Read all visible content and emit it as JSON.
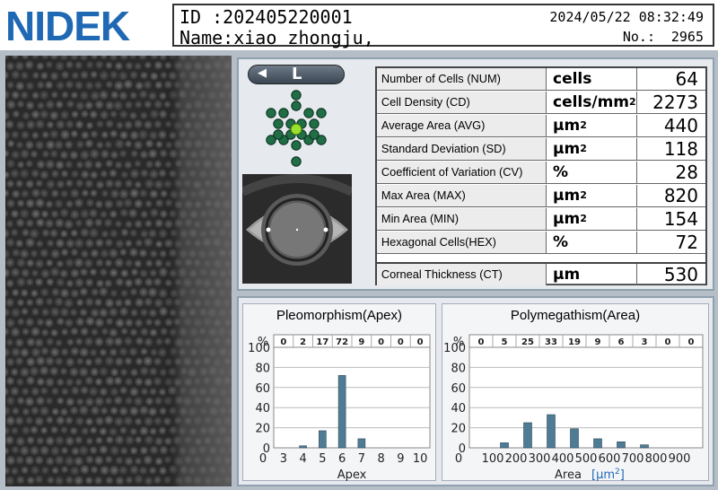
{
  "header": {
    "brand": "NIDEK",
    "id_line": "ID  :202405220001",
    "name_line": "Name:xiao zhongju,",
    "datetime": "2024/05/22 08:32:49",
    "no_label": "No.:",
    "no_value": "2965"
  },
  "eye": {
    "label": "L",
    "arrow_icon": "left-arrow-icon",
    "fixation_active_color": "#9be02c"
  },
  "measurements": [
    {
      "label": "Number of Cells (NUM)",
      "unit": "cells",
      "value": "64"
    },
    {
      "label": "Cell Density (CD)",
      "unit": "cells/mm",
      "unit_sup": "2",
      "value": "2273"
    },
    {
      "label": "Average Area (AVG)",
      "unit": "µm",
      "unit_sup": "2",
      "value": "440"
    },
    {
      "label": "Standard Deviation (SD)",
      "unit": "µm",
      "unit_sup": "2",
      "value": "118"
    },
    {
      "label": "Coefficient of Variation (CV)",
      "unit": "%",
      "value": "28"
    },
    {
      "label": "Max Area (MAX)",
      "unit": "µm",
      "unit_sup": "2",
      "value": "820"
    },
    {
      "label": "Min Area (MIN)",
      "unit": "µm",
      "unit_sup": "2",
      "value": "154"
    },
    {
      "label": "Hexagonal Cells(HEX)",
      "unit": "%",
      "value": "72"
    },
    {
      "label": "Corneal Thickness (CT)",
      "unit": "µm",
      "value": "530"
    }
  ],
  "colors": {
    "bar": "#4f7c94",
    "brand": "#1f69b4"
  },
  "chart_data": [
    {
      "type": "bar",
      "title": "Pleomorphism(Apex)",
      "xlabel": "Apex",
      "ylabel": "%",
      "ylim": [
        0,
        100
      ],
      "yticks": [
        0,
        20,
        40,
        60,
        80,
        100
      ],
      "categories": [
        "3",
        "4",
        "5",
        "6",
        "7",
        "8",
        "9",
        "10"
      ],
      "counts_top": [
        "0",
        "2",
        "17",
        "72",
        "9",
        "0",
        "0",
        "0"
      ],
      "values": [
        0,
        2,
        17,
        72,
        9,
        0,
        0,
        0
      ],
      "x_zero_label": "0",
      "grid": true
    },
    {
      "type": "bar",
      "title": "Polymegathism(Area)",
      "xlabel": "Area",
      "xlabel_unit": "µm",
      "xlabel_unit_sup": "2",
      "ylabel": "%",
      "ylim": [
        0,
        100
      ],
      "yticks": [
        0,
        20,
        40,
        60,
        80,
        100
      ],
      "categories": [
        "100",
        "200",
        "300",
        "400",
        "500",
        "600",
        "700",
        "800",
        "900"
      ],
      "counts_top": [
        "0",
        "5",
        "25",
        "33",
        "19",
        "9",
        "6",
        "3",
        "0",
        "0"
      ],
      "values": [
        0,
        5,
        25,
        33,
        19,
        9,
        6,
        3,
        0,
        0
      ],
      "x_zero_label": "0",
      "grid": true
    }
  ]
}
